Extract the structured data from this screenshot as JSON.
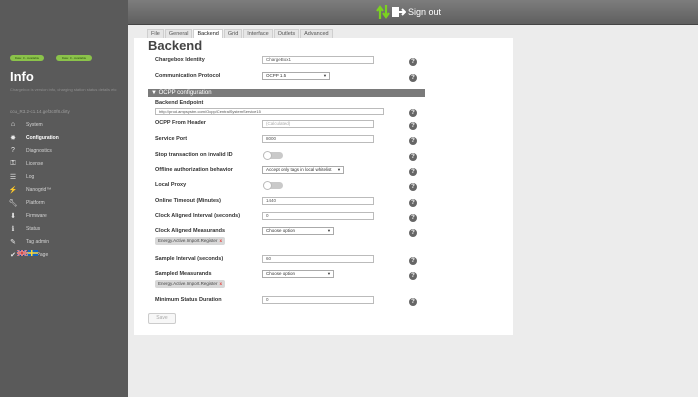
{
  "header": {
    "signout_label": "Sign out"
  },
  "sidebar": {
    "pills": [
      "Date: 0 - Available",
      "Date: 0 - Available"
    ],
    "title": "Info",
    "description": "Chargebox is version info, charging station status details etc",
    "version": "ccu_R3.2-c1.14.gef3c0f8.dirty",
    "items": [
      {
        "icon": "home-icon",
        "label": "System",
        "active": false
      },
      {
        "icon": "gear-icon",
        "label": "Configuration",
        "active": true
      },
      {
        "icon": "question-icon",
        "label": "Diagnostics",
        "active": false
      },
      {
        "icon": "license-icon",
        "label": "License",
        "active": false
      },
      {
        "icon": "log-icon",
        "label": "Log",
        "active": false
      },
      {
        "icon": "nanogrid-icon",
        "label": "Nanogrid™",
        "active": false
      },
      {
        "icon": "wrench-icon",
        "label": "Platform",
        "active": false
      },
      {
        "icon": "firmware-icon",
        "label": "Firmware",
        "active": false
      },
      {
        "icon": "info-icon",
        "label": "Status",
        "active": false
      },
      {
        "icon": "pencil-icon",
        "label": "Tag admin",
        "active": false
      },
      {
        "icon": "check-icon",
        "label": "Test Page",
        "active": false
      }
    ]
  },
  "tabs": [
    "File",
    "General",
    "Backend",
    "Grid",
    "Interface",
    "Outlets",
    "Advanced"
  ],
  "active_tab": "Backend",
  "page_title": "Backend",
  "fields": {
    "chargebox_identity": {
      "label": "Chargebox Identity",
      "value": "ChargeBox1"
    },
    "communication_protocol": {
      "label": "Communication Protocol",
      "value": "OCPP 1.5"
    },
    "section_ocpp": "▼ OCPP configuration",
    "backend_endpoint": {
      "label": "Backend Endpoint",
      "value": "http://prod.ampsystm.com/Ocpp/CentralSystemService15"
    },
    "ocpp_from_header": {
      "label": "OCPP From Header",
      "placeholder": "(Calculated)"
    },
    "service_port": {
      "label": "Service Port",
      "value": "8000"
    },
    "stop_transaction": {
      "label": "Stop transaction on invalid ID"
    },
    "offline_auth": {
      "label": "Offline authorization behavior",
      "value": "Accept only tags in local whitelist"
    },
    "local_proxy": {
      "label": "Local Proxy"
    },
    "online_timeout": {
      "label": "Online Timeout (Minutes)",
      "value": "1440"
    },
    "clock_aligned_interval": {
      "label": "Clock Aligned Interval (seconds)",
      "value": "0"
    },
    "clock_aligned_measurands": {
      "label": "Clock Aligned Measurands",
      "select": "Choose option",
      "tag": "Energy.Active.Import.Register"
    },
    "sample_interval": {
      "label": "Sample Interval (seconds)",
      "value": "60"
    },
    "sampled_measurands": {
      "label": "Sampled Measurands",
      "select": "Choose option",
      "tag": "Energy.Active.Import.Register"
    },
    "min_status_duration": {
      "label": "Minimum Status Duration",
      "value": "0"
    }
  },
  "help_glyph": "?",
  "tag_remove_glyph": "x",
  "save_label": "Save"
}
